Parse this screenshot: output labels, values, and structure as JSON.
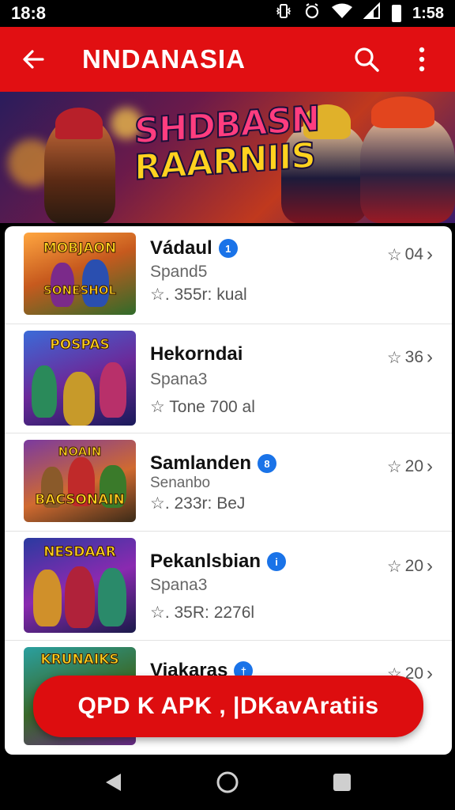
{
  "status_bar": {
    "left_time": "18:8",
    "right_time": "1:58",
    "icons": [
      "vibrate-icon",
      "alarm-icon",
      "wifi-icon",
      "signal-icon",
      "battery-icon"
    ]
  },
  "app_bar": {
    "title": "NNDANASIA",
    "back_icon": "arrow-left-icon",
    "search_icon": "search-icon",
    "menu_icon": "more-vert-icon",
    "color": "#e10f12"
  },
  "banner": {
    "line1": "SHDBASN",
    "line2": "RAARNIIS"
  },
  "apps": [
    {
      "thumb_text": "MOBJAON",
      "thumb_sub": "SONESHOL",
      "name": "Vádaul",
      "badge": "1",
      "subtitle": "Spand5",
      "meta": "☆. 355r: kual",
      "rating": "04"
    },
    {
      "thumb_text": "POSPAS",
      "thumb_sub": "",
      "name": "Hekorndai",
      "badge": "",
      "subtitle": "Spana3",
      "meta": "☆ Tone 700 al",
      "rating": "36"
    },
    {
      "thumb_text": "NOAIN",
      "thumb_sub": "BACSONAIN",
      "name": "Samlanden",
      "badge": "8",
      "subtitle": "Senanbo",
      "meta": "☆. 233r: BeJ",
      "rating": "20"
    },
    {
      "thumb_text": "NESDAAR",
      "thumb_sub": "",
      "name": "Pekanlsbian",
      "badge": "i",
      "subtitle": "Spana3",
      "meta": "☆. 35R: 2276l",
      "rating": "20"
    },
    {
      "thumb_text": "KRUNAIKS",
      "thumb_sub": "",
      "name": "Viakaras",
      "badge": "†",
      "subtitle": "",
      "meta": "",
      "rating": "20"
    }
  ],
  "cta_label": "QPD K APK , |DKavAratiis",
  "nav": {
    "back": "nav-back-icon",
    "home": "nav-home-icon",
    "recents": "nav-recents-icon"
  }
}
